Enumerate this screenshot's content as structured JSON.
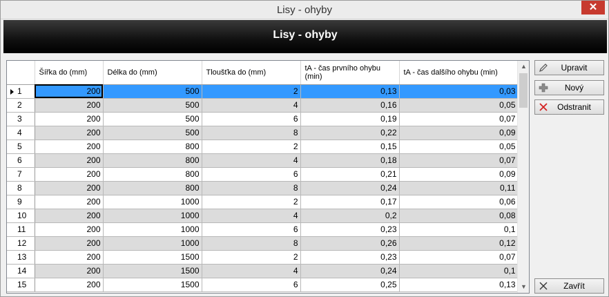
{
  "window": {
    "title": "Lisy - ohyby",
    "close_glyph": "✕"
  },
  "banner": {
    "title": "Lisy - ohyby"
  },
  "grid": {
    "columns": [
      "Šířka do (mm)",
      "Délka do (mm)",
      "Tloušťka do (mm)",
      "tA - čas prvního ohybu (min)",
      "tA - čas dalšího ohybu (min)"
    ],
    "selected_row": 1,
    "rows": [
      {
        "n": "1",
        "cells": [
          "200",
          "500",
          "2",
          "0,13",
          "0,03"
        ]
      },
      {
        "n": "2",
        "cells": [
          "200",
          "500",
          "4",
          "0,16",
          "0,05"
        ]
      },
      {
        "n": "3",
        "cells": [
          "200",
          "500",
          "6",
          "0,19",
          "0,07"
        ]
      },
      {
        "n": "4",
        "cells": [
          "200",
          "500",
          "8",
          "0,22",
          "0,09"
        ]
      },
      {
        "n": "5",
        "cells": [
          "200",
          "800",
          "2",
          "0,15",
          "0,05"
        ]
      },
      {
        "n": "6",
        "cells": [
          "200",
          "800",
          "4",
          "0,18",
          "0,07"
        ]
      },
      {
        "n": "7",
        "cells": [
          "200",
          "800",
          "6",
          "0,21",
          "0,09"
        ]
      },
      {
        "n": "8",
        "cells": [
          "200",
          "800",
          "8",
          "0,24",
          "0,11"
        ]
      },
      {
        "n": "9",
        "cells": [
          "200",
          "1000",
          "2",
          "0,17",
          "0,06"
        ]
      },
      {
        "n": "10",
        "cells": [
          "200",
          "1000",
          "4",
          "0,2",
          "0,08"
        ]
      },
      {
        "n": "11",
        "cells": [
          "200",
          "1000",
          "6",
          "0,23",
          "0,1"
        ]
      },
      {
        "n": "12",
        "cells": [
          "200",
          "1000",
          "8",
          "0,26",
          "0,12"
        ]
      },
      {
        "n": "13",
        "cells": [
          "200",
          "1500",
          "2",
          "0,23",
          "0,07"
        ]
      },
      {
        "n": "14",
        "cells": [
          "200",
          "1500",
          "4",
          "0,24",
          "0,1"
        ]
      },
      {
        "n": "15",
        "cells": [
          "200",
          "1500",
          "6",
          "0,25",
          "0,13"
        ]
      }
    ]
  },
  "buttons": {
    "edit": "Upravit",
    "new": "Nový",
    "delete": "Odstranit",
    "close": "Zavřít"
  },
  "icons": {
    "edit": "pencil-icon",
    "new": "plus-icon",
    "delete": "red-x-icon",
    "close": "x-icon"
  },
  "colors": {
    "selection": "#3399ff",
    "alt_row": "#dcdcdc",
    "close_button": "#c73a2f",
    "delete_icon": "#d42020"
  }
}
